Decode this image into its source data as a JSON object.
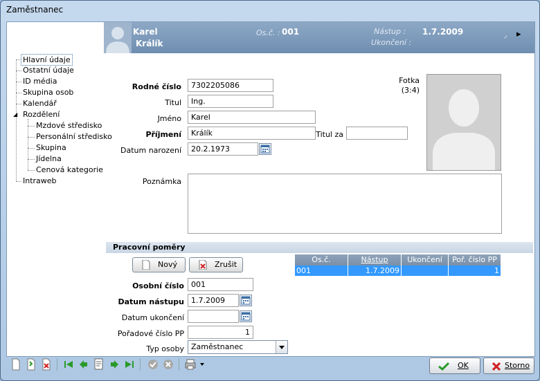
{
  "window": {
    "title": "Zaměstnanec"
  },
  "tree": [
    {
      "label": "Hlavní údaje",
      "level": 0,
      "selected": true
    },
    {
      "label": "Ostatní údaje",
      "level": 0
    },
    {
      "label": "ID média",
      "level": 0
    },
    {
      "label": "Skupina osob",
      "level": 0
    },
    {
      "label": "Kalendář",
      "level": 0
    },
    {
      "label": "Rozdělení",
      "level": 0,
      "expanded": true
    },
    {
      "label": "Mzdové středisko",
      "level": 1
    },
    {
      "label": "Personální středisko",
      "level": 1
    },
    {
      "label": "Skupina",
      "level": 1
    },
    {
      "label": "Jídelna",
      "level": 1
    },
    {
      "label": "Cenová kategorie",
      "level": 1
    },
    {
      "label": "Intraweb",
      "level": 0
    }
  ],
  "header": {
    "first_name": "Karel",
    "last_name": "Králík",
    "oscis_label": "Os.č. :",
    "oscis_value": "001",
    "nastup_label": "Nástup :",
    "nastup_value": "1.7.2009",
    "ukonceni_label": "Ukončení :",
    "nav_symbol": "▸"
  },
  "form": {
    "rodne_cislo_label": "Rodné číslo",
    "rodne_cislo": "7302205086",
    "titul_label": "Titul",
    "titul": "Ing.",
    "jmeno_label": "Jméno",
    "jmeno": "Karel",
    "prijmeni_label": "Příjmení",
    "prijmeni": "Králík",
    "titul_za_label": "Titul za",
    "titul_za": "",
    "datum_narozeni_label": "Datum narození",
    "datum_narozeni": "20.2.1973",
    "poznamka_label": "Poznámka",
    "poznamka": "",
    "fotka_label": "Fotka",
    "fotka_ratio": "(3:4)"
  },
  "pp": {
    "section_title": "Pracovní poměry",
    "new_label": "Nový",
    "delete_label": "Zrušit",
    "grid_headers": [
      "Os.č.",
      "Nástup",
      "Ukončení",
      "Poř. číslo PP"
    ],
    "grid_rows": [
      [
        "001",
        "1.7.2009",
        "",
        "1"
      ]
    ],
    "osobni_cislo_label": "Osobní číslo",
    "osobni_cislo": "001",
    "datum_nastupu_label": "Datum nástupu",
    "datum_nastupu": "1.7.2009",
    "datum_ukonceni_label": "Datum ukončení",
    "datum_ukonceni": "",
    "poradove_cislo_label": "Pořadové číslo PP",
    "poradove_cislo": "1",
    "typ_osoby_label": "Typ osoby",
    "typ_osoby": "Zaměstnanec"
  },
  "footer": {
    "ok_label": "OK",
    "storno_label": "Storno"
  },
  "colors": {
    "header_bg": "#7a97b8",
    "selection": "#3399ff",
    "grid_header": "#8299b2"
  }
}
